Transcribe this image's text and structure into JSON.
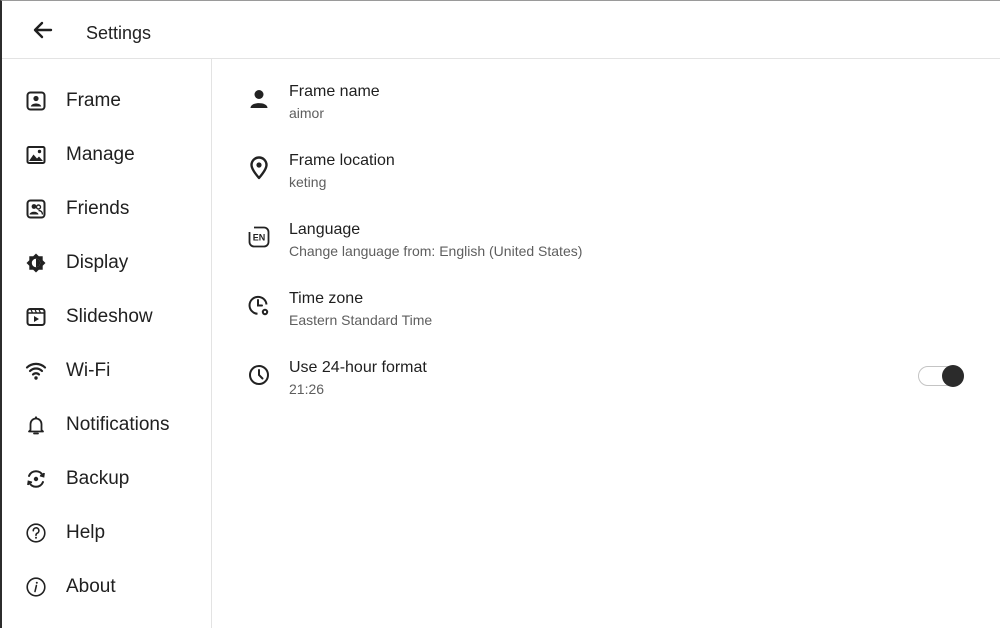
{
  "header": {
    "title": "Settings",
    "back_icon": "arrow-left-icon"
  },
  "sidebar": {
    "items": [
      {
        "label": "Frame",
        "icon": "frame-portrait-icon"
      },
      {
        "label": "Manage",
        "icon": "image-gallery-icon"
      },
      {
        "label": "Friends",
        "icon": "contacts-icon"
      },
      {
        "label": "Display",
        "icon": "brightness-icon"
      },
      {
        "label": "Slideshow",
        "icon": "slideshow-icon"
      },
      {
        "label": "Wi-Fi",
        "icon": "wifi-icon"
      },
      {
        "label": "Notifications",
        "icon": "bell-icon"
      },
      {
        "label": "Backup",
        "icon": "backup-sync-icon"
      },
      {
        "label": "Help",
        "icon": "help-icon"
      },
      {
        "label": "About",
        "icon": "info-icon"
      }
    ]
  },
  "settings": {
    "frame_name": {
      "title": "Frame name",
      "value": "aimor",
      "icon": "person-icon"
    },
    "frame_location": {
      "title": "Frame location",
      "value": "keting",
      "icon": "location-pin-icon"
    },
    "language": {
      "title": "Language",
      "value": "Change language from: English (United States)",
      "icon": "language-en-icon"
    },
    "time_zone": {
      "title": "Time zone",
      "value": "Eastern Standard Time",
      "icon": "timezone-clock-icon"
    },
    "hour_format": {
      "title": "Use 24-hour format",
      "value": "21:26",
      "icon": "clock-icon",
      "enabled": true
    }
  }
}
